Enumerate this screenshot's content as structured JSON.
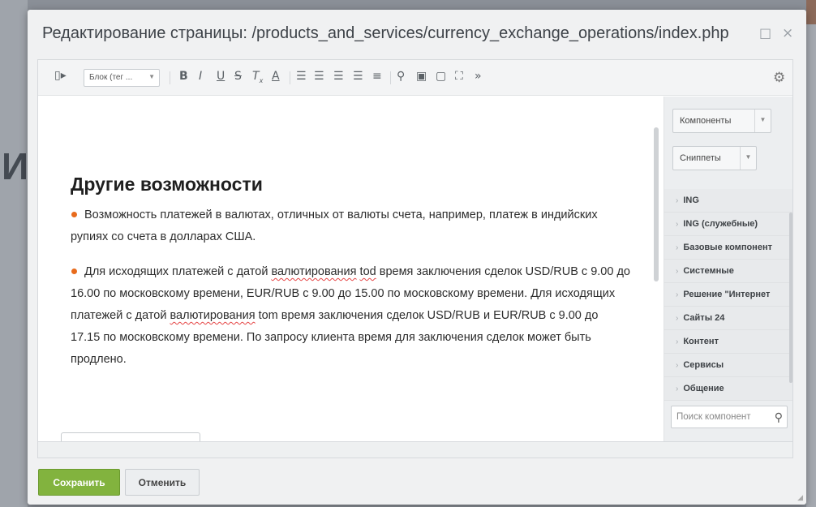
{
  "dialog": {
    "title": "Редактирование страницы: /products_and_services/currency_exchange_operations/index.php",
    "restore_icon": "restore-icon",
    "close_icon": "close-icon"
  },
  "toolbar": {
    "format_select": "Блок (тег ...",
    "items": [
      "view-toggle-icon",
      "bold-icon",
      "italic-icon",
      "underline-icon",
      "strike-icon",
      "remove-format-icon",
      "text-color-icon",
      "ordered-list-icon",
      "bullet-list-icon",
      "outdent-icon",
      "indent-icon",
      "align-icon",
      "link-icon",
      "image-icon",
      "video-icon",
      "fullscreen-icon",
      "more-icon"
    ]
  },
  "content": {
    "heading": "Другие возможности",
    "p1": {
      "text": "Возможность платежей в валютах, отличных от валюты счета, например, платеж в индийских рупиях со счета в долларах США."
    },
    "p2": {
      "part1": "Для исходящих платежей с датой ",
      "word1": "валютирования",
      "part2": " ",
      "word2": "tod",
      "part3": " время заключения сделок USD/RUB с 9.00 до 16.00 по московскому времени, EUR/RUB с 9.00 до 15.00 по московскому времени. Для исходящих платежей с датой ",
      "word3": "валютирования",
      "part4": " tom время заключения сделок USD/RUB и EUR/RUB с 9.00 до 17.15 по московскому времени. По запросу клиента время для заключения сделок может быть продлено."
    }
  },
  "sidebar": {
    "components_label": "Компоненты",
    "snippets_label": "Сниппеты",
    "items": [
      "ING",
      "ING (служебные)",
      "Базовые компонент",
      "Системные",
      "Решение \"Интернет",
      "Сайты 24",
      "Контент",
      "Сервисы",
      "Общение"
    ],
    "search_placeholder": "Поиск компонент"
  },
  "footer": {
    "save_label": "Сохранить",
    "cancel_label": "Отменить"
  },
  "colors": {
    "accent_green": "#82b33e",
    "bullet_orange": "#e86b1c",
    "spell_underline": "#e54444"
  }
}
